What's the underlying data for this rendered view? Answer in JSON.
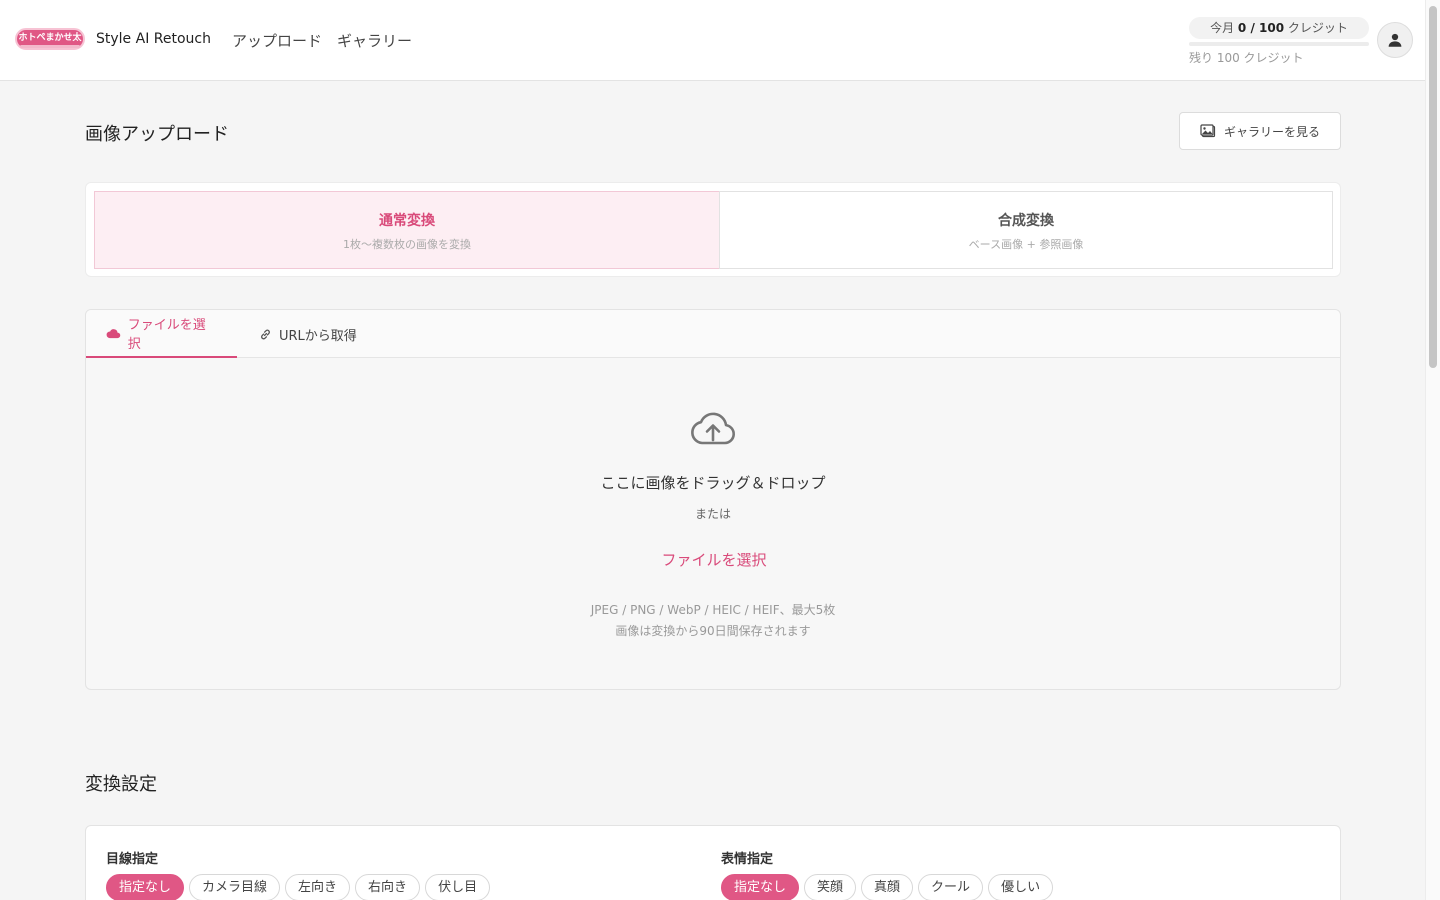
{
  "header": {
    "logo_text": "ホトペまかせ太",
    "brand": "Style AI Retouch",
    "nav": [
      "アップロード",
      "ギャラリー"
    ],
    "credits": {
      "prefix": "今月 ",
      "used_total": "0 / 100",
      "suffix": " クレジット",
      "remaining": "残り 100 クレジット",
      "used_fraction": 0
    }
  },
  "page": {
    "title": "画像アップロード",
    "gallery_button": "ギャラリーを見る"
  },
  "modes": [
    {
      "title": "通常変換",
      "subtitle": "1枚〜複数枚の画像を変換",
      "active": true
    },
    {
      "title": "合成変換",
      "subtitle": "ベース画像 + 参照画像",
      "active": false
    }
  ],
  "upload": {
    "tabs": [
      {
        "label": "ファイルを選択",
        "icon": "cloud-icon",
        "active": true
      },
      {
        "label": "URLから取得",
        "icon": "link-icon",
        "active": false
      }
    ],
    "drop_text": "ここに画像をドラッグ＆ドロップ",
    "or_text": "または",
    "select_file": "ファイルを選択",
    "formats": "JPEG / PNG / WebP / HEIC / HEIF、最大5枚",
    "retention": "画像は変換から90日間保存されます"
  },
  "settings": {
    "title": "変換設定",
    "gaze": {
      "label": "目線指定",
      "options": [
        "指定なし",
        "カメラ目線",
        "左向き",
        "右向き",
        "伏し目"
      ],
      "selected": 0
    },
    "expression": {
      "label": "表情指定",
      "options": [
        "指定なし",
        "笑顔",
        "真顔",
        "クール",
        "優しい"
      ],
      "selected": 0
    }
  },
  "colors": {
    "accent": "#e05785",
    "accent_light": "#fdeef3"
  }
}
